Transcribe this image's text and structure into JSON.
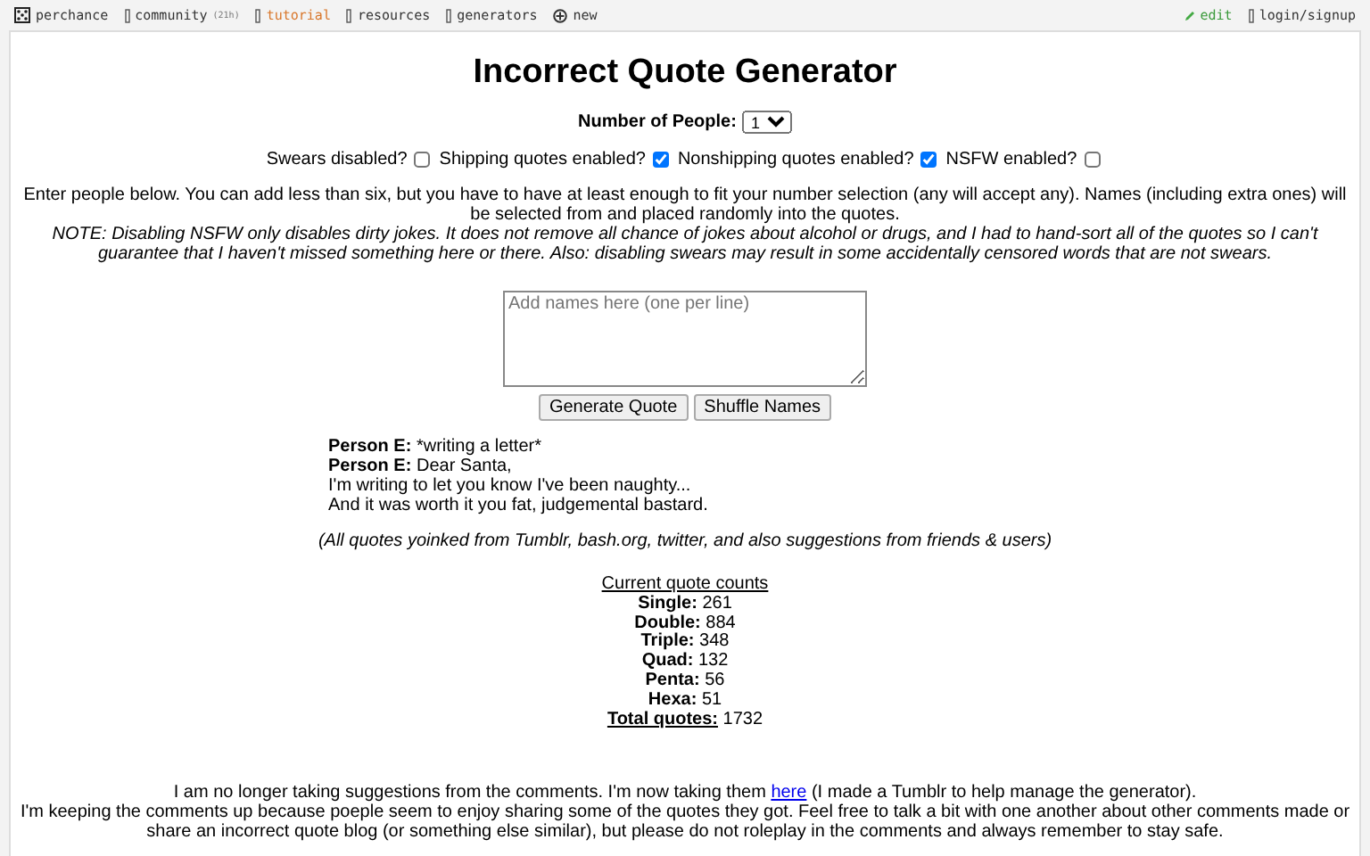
{
  "nav": {
    "left": [
      {
        "kind": "dice",
        "label": "perchance",
        "highlight": false
      },
      {
        "kind": "box",
        "label": "community",
        "badge": "(21h)",
        "highlight": false
      },
      {
        "kind": "box",
        "label": "tutorial",
        "highlight": true
      },
      {
        "kind": "box",
        "label": "resources",
        "highlight": false
      },
      {
        "kind": "box",
        "label": "generators",
        "highlight": false
      },
      {
        "kind": "plus",
        "label": "new",
        "highlight": false
      }
    ],
    "right": [
      {
        "kind": "pencil",
        "label": "edit",
        "highlight": true
      },
      {
        "kind": "box",
        "label": "login/signup",
        "highlight": false
      }
    ]
  },
  "title": "Incorrect Quote Generator",
  "people": {
    "label": "Number of People:",
    "value": "1"
  },
  "toggles": [
    {
      "label": "Swears disabled?",
      "checked": false
    },
    {
      "label": "Shipping quotes enabled?",
      "checked": true
    },
    {
      "label": "Nonshipping quotes enabled?",
      "checked": true
    },
    {
      "label": "NSFW enabled?",
      "checked": false
    }
  ],
  "instructions": "Enter people below. You can add less than six, but you have to have at least enough to fit your number selection (any will accept any). Names (including extra ones) will be selected from and placed randomly into the quotes.",
  "note": "NOTE: Disabling NSFW only disables dirty jokes. It does not remove all chance of jokes about alcohol or drugs, and I had to hand-sort all of the quotes so I can't guarantee that I haven't missed something here or there. Also: disabling swears may result in some accidentally censored words that are not swears.",
  "names": {
    "placeholder": "Add names here (one per line)"
  },
  "buttons": [
    "Generate Quote",
    "Shuffle Names"
  ],
  "quote": [
    {
      "speaker": "Person E:",
      "text": "*writing a letter*"
    },
    {
      "speaker": "Person E:",
      "text": "Dear Santa,"
    },
    {
      "text": "I'm writing to let you know I've been naughty..."
    },
    {
      "text": "And it was worth it you fat, judgemental bastard."
    }
  ],
  "credits": "(All quotes yoinked from Tumblr, bash.org, twitter, and also suggestions from friends & users)",
  "counts": {
    "heading": "Current quote counts",
    "rows": [
      {
        "label": "Single:",
        "value": "261"
      },
      {
        "label": "Double:",
        "value": "884"
      },
      {
        "label": "Triple:",
        "value": "348"
      },
      {
        "label": "Quad:",
        "value": "132"
      },
      {
        "label": "Penta:",
        "value": "56"
      },
      {
        "label": "Hexa:",
        "value": "51"
      }
    ],
    "total": {
      "label": "Total quotes:",
      "value": "1732"
    }
  },
  "footer": {
    "before": "I am no longer taking suggestions from the comments. I'm now taking them ",
    "link": "here",
    "after": " (I made a Tumblr to help manage the generator).",
    "paragraph": "I'm keeping the comments up because poeple seem to enjoy sharing some of the quotes they got. Feel free to talk a bit with one another about other comments made or share an incorrect quote blog (or something else similar), but please do not roleplay in the comments and always remember to stay safe."
  }
}
